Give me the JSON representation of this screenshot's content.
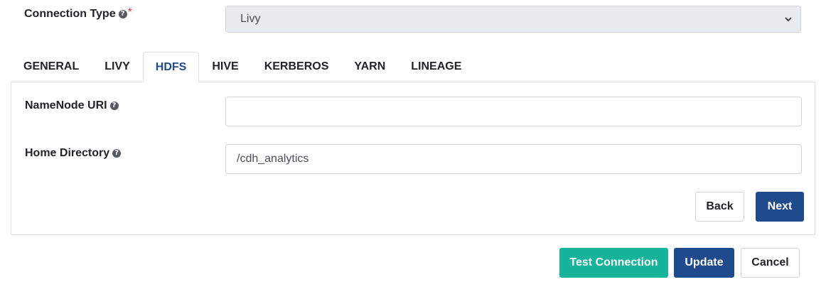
{
  "connection_type": {
    "label": "Connection Type",
    "required_marker": "*",
    "help_icon": "question-circle-icon",
    "selected_value": "Livy",
    "dropdown_icon": "chevron-down-icon"
  },
  "tabs": [
    {
      "label": "GENERAL",
      "active": false
    },
    {
      "label": "LIVY",
      "active": false
    },
    {
      "label": "HDFS",
      "active": true
    },
    {
      "label": "HIVE",
      "active": false
    },
    {
      "label": "KERBEROS",
      "active": false
    },
    {
      "label": "YARN",
      "active": false
    },
    {
      "label": "LINEAGE",
      "active": false
    }
  ],
  "hdfs_form": {
    "namenode_uri": {
      "label": "NameNode URI",
      "help_icon": "question-circle-icon",
      "value": ""
    },
    "home_directory": {
      "label": "Home Directory",
      "help_icon": "question-circle-icon",
      "value": "/cdh_analytics"
    },
    "back_label": "Back",
    "next_label": "Next"
  },
  "footer": {
    "test_connection_label": "Test Connection",
    "update_label": "Update",
    "cancel_label": "Cancel"
  },
  "colors": {
    "primary": "#1f4a8c",
    "teal": "#17b39a",
    "required": "#dc3545",
    "active_tab_text": "#1f4a8c",
    "select_bg": "#e9ecef"
  }
}
